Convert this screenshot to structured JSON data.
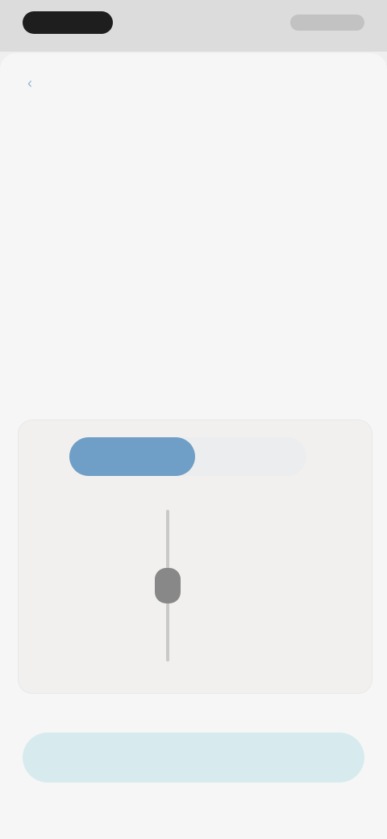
{
  "status_bar": {
    "time": "",
    "icons_text": ""
  },
  "nav": {
    "back_label": ""
  },
  "header": {
    "title": ""
  },
  "details": {
    "section_label": "",
    "sub_label": "",
    "row1": {
      "key": "",
      "value": ""
    },
    "row2": {
      "key": "",
      "value": ""
    },
    "row3": {
      "key": ""
    },
    "info_link": ""
  },
  "control": {
    "section_label": "",
    "segment_left": "",
    "segment_right": "",
    "slider_top_label": "",
    "slider_bottom_label": "",
    "slider_value": ""
  },
  "footer": {
    "primary_button": ""
  },
  "colors": {
    "accent": "#6f9fc6",
    "primary_button_bg": "#d7ebee"
  }
}
